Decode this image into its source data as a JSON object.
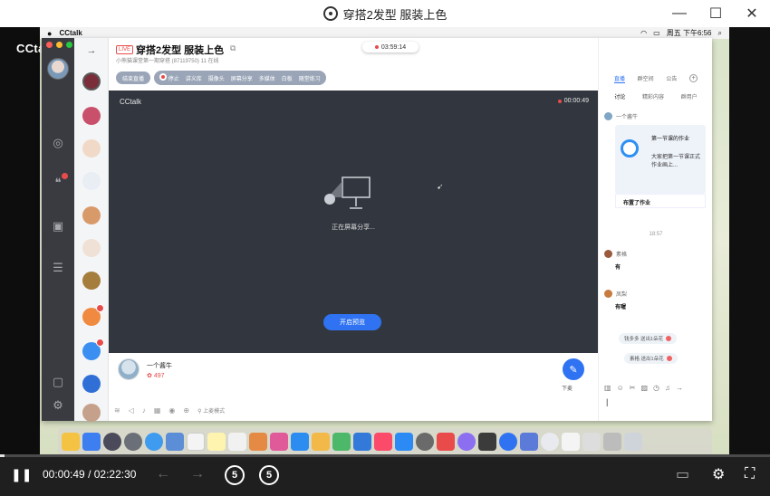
{
  "player": {
    "title": "穿搭2发型 服装上色",
    "window_controls": [
      "—",
      "☐",
      "✕"
    ],
    "watermark": "CCtalk",
    "current_time": "00:00:49",
    "separator": "/",
    "duration": "02:22:30",
    "progress_fraction": 0.0057,
    "skip_back_label": "5",
    "skip_forward_label": "5"
  },
  "mac_menubar": {
    "apple": "",
    "app_name": "CCtalk",
    "status_text": "周五 下午6:56",
    "wifi_icon": "wifi-icon",
    "battery_icon": "battery-icon",
    "search_icon": "search-icon"
  },
  "rail": {
    "icons": [
      "planet-icon",
      "chat-icon",
      "calendar-icon",
      "contacts-icon"
    ],
    "bottom_icons": [
      "message-icon",
      "settings-icon"
    ]
  },
  "course": {
    "live_tag": "LIVE",
    "title": "穿搭2发型 服装上色",
    "subtitle": "小熊猫课堂第一期穿搭 (87119750)   11 在线",
    "timer": "03:59:14"
  },
  "toolbar": {
    "end_live": "结束直播",
    "stop": "停止",
    "materials": "讲义库",
    "camera": "摄像头",
    "screen_share": "屏幕分享",
    "multimedia": "多媒体",
    "whiteboard": "白板",
    "practice": "随堂练习"
  },
  "stage": {
    "label": "CCtalk",
    "time": "00:00:49",
    "sharing_text": "正在屏幕分享...",
    "preview_button": "开启预览"
  },
  "teacher": {
    "name": "一个酱牛",
    "flowers": "497",
    "hands_label": "下麦"
  },
  "bottom_tools": {
    "stage_mode": "上麦模式"
  },
  "side": {
    "tabs": [
      "直播",
      "群空间",
      "公告"
    ],
    "subtabs": [
      "讨论",
      "精彩内容",
      "群用户"
    ],
    "first_user": "一个酱牛",
    "homework_title": "第一节课的作业",
    "homework_body": "大家把第一节课正式作业画上...",
    "homework_footer": "布置了作业",
    "chat_time": "18:57",
    "messages": [
      {
        "user": "素格",
        "text": "有"
      },
      {
        "user": "凤梨",
        "text": "有喔"
      }
    ],
    "gifts": [
      "钱多多 送出1朵花",
      "素格 送出1朵花"
    ]
  },
  "colors": {
    "accent": "#2f73f2",
    "live_red": "#e94b4b",
    "stage_bg": "#32373f",
    "rail_bg": "#3a3b40",
    "controls_bg": "#1f1f1f"
  }
}
